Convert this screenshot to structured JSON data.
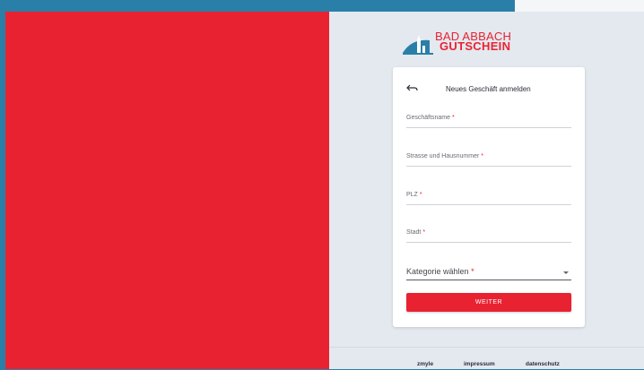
{
  "brand": {
    "line1": "BAD ABBACH",
    "line2": "GUTSCHEIN",
    "colors": {
      "red": "#e92232",
      "blue": "#2a7fa8"
    }
  },
  "card": {
    "back_icon": "arrow-left-icon",
    "title": "Neues Geschäft anmelden"
  },
  "fields": [
    {
      "label": "Geschäftsname",
      "required": "*"
    },
    {
      "label": "Strasse und Hausnummer",
      "required": "*"
    },
    {
      "label": "PLZ",
      "required": "*"
    },
    {
      "label": "Stadt",
      "required": "*"
    }
  ],
  "category_select": {
    "label": "Kategorie wählen",
    "required": "*"
  },
  "submit_label": "WEITER",
  "footer": {
    "links": [
      "zmyle",
      "impressum",
      "datenschutz"
    ]
  }
}
